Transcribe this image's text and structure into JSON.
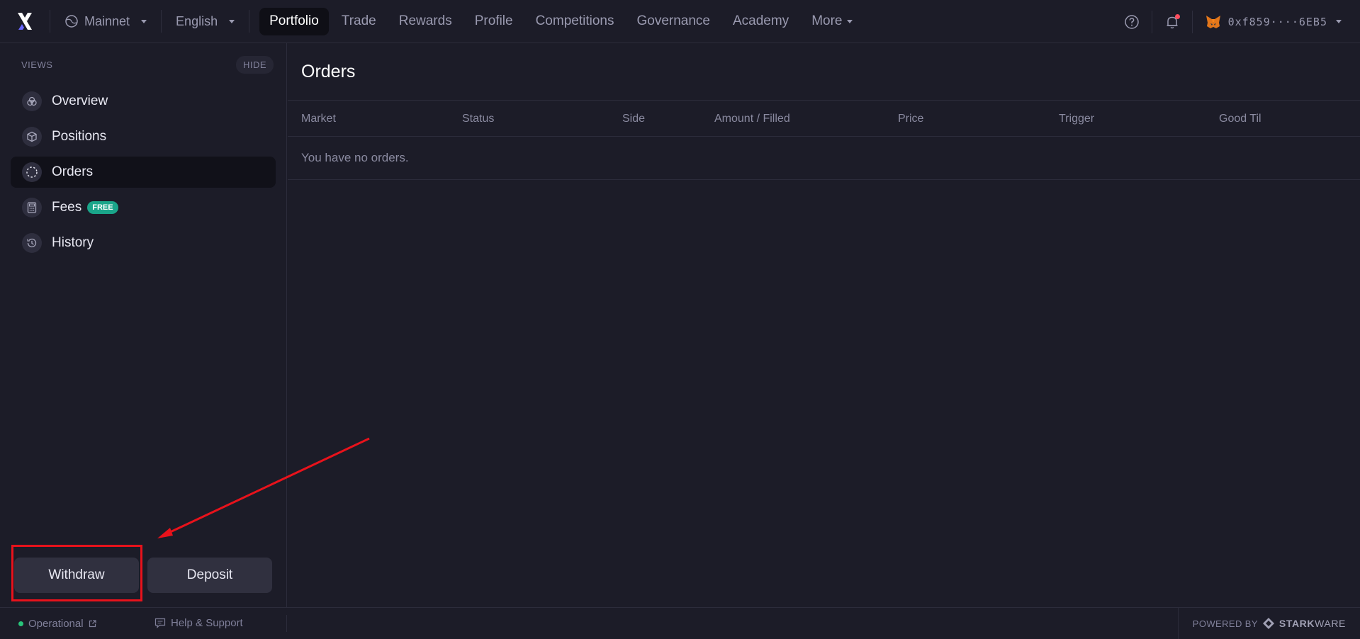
{
  "topbar": {
    "network": "Mainnet",
    "language": "English",
    "nav": [
      {
        "label": "Portfolio",
        "active": true
      },
      {
        "label": "Trade"
      },
      {
        "label": "Rewards"
      },
      {
        "label": "Profile"
      },
      {
        "label": "Competitions"
      },
      {
        "label": "Governance"
      },
      {
        "label": "Academy"
      },
      {
        "label": "More"
      }
    ],
    "wallet_address": "0xf859····6EB5"
  },
  "sidebar": {
    "views_label": "VIEWS",
    "hide_label": "HIDE",
    "items": [
      {
        "label": "Overview",
        "icon": "overview-icon"
      },
      {
        "label": "Positions",
        "icon": "cube-icon"
      },
      {
        "label": "Orders",
        "icon": "dashed-circle-icon",
        "active": true
      },
      {
        "label": "Fees",
        "icon": "calculator-icon",
        "badge": "FREE"
      },
      {
        "label": "History",
        "icon": "clock-icon"
      }
    ],
    "withdraw_label": "Withdraw",
    "deposit_label": "Deposit"
  },
  "main": {
    "title": "Orders",
    "columns": [
      "Market",
      "Status",
      "Side",
      "Amount / Filled",
      "Price",
      "Trigger",
      "Good Til"
    ],
    "empty_message": "You have no orders."
  },
  "footer": {
    "status": "Operational",
    "help": "Help & Support",
    "powered_by": "POWERED BY",
    "brand_bold": "STARK",
    "brand_rest": "WARE"
  },
  "colors": {
    "background": "#1c1c28",
    "accent_badge": "#1aa58a",
    "highlight": "#e8121b",
    "status_green": "#28c47a"
  }
}
